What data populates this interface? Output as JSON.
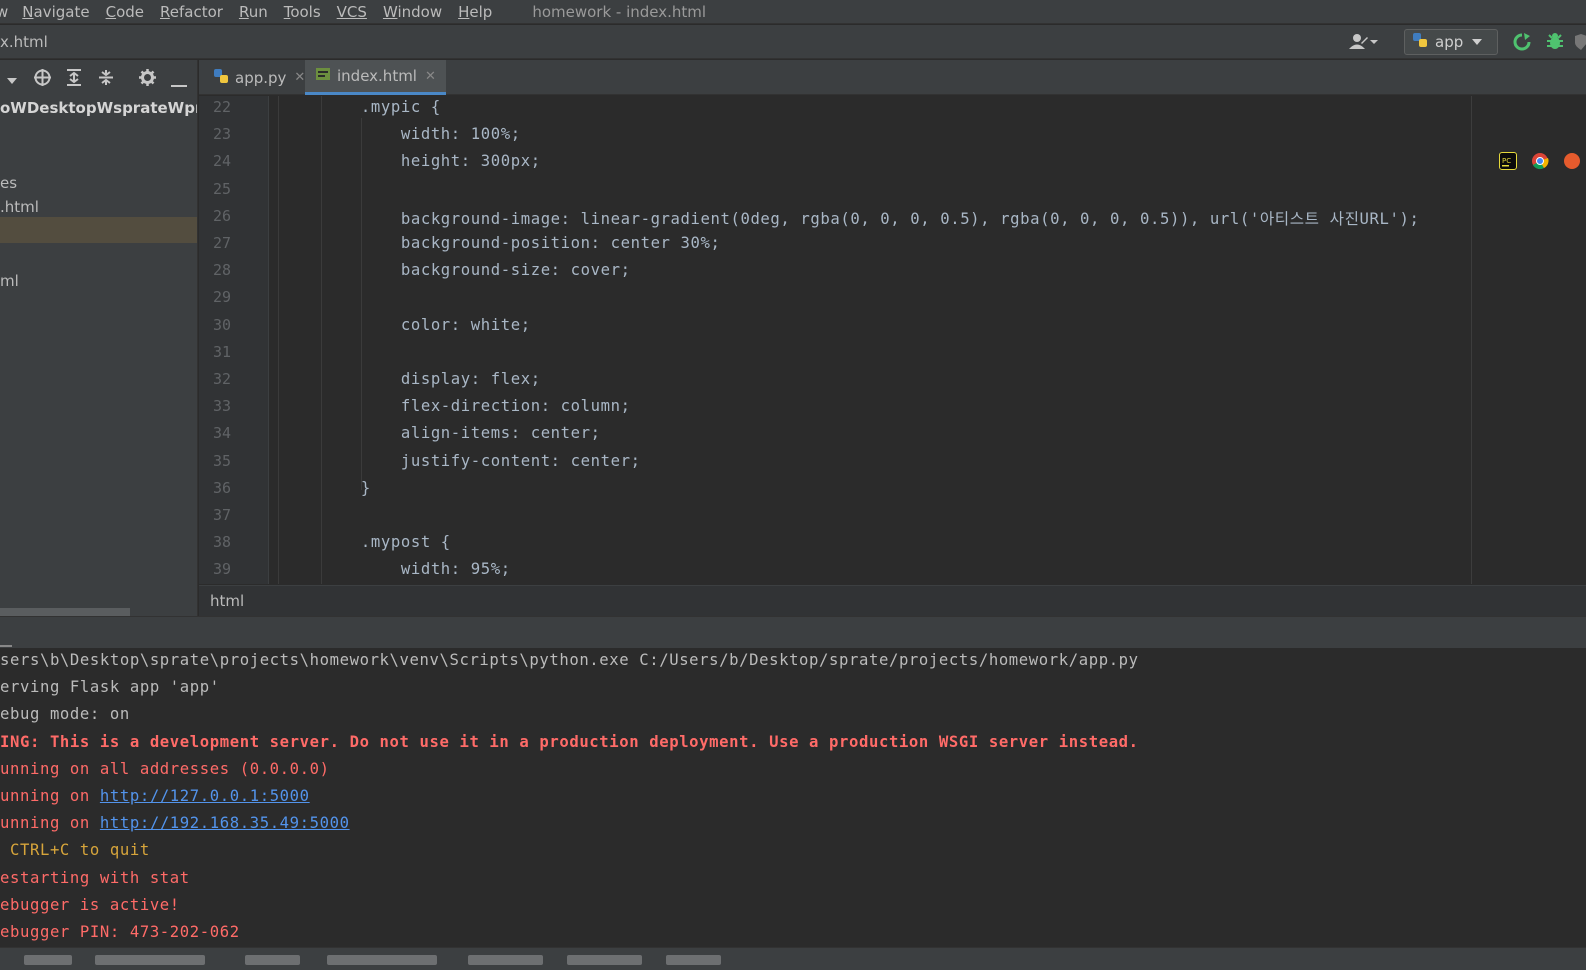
{
  "menu": {
    "partial_first": "w",
    "items": [
      {
        "mnemonic": "N",
        "rest": "avigate"
      },
      {
        "mnemonic": "C",
        "rest": "ode"
      },
      {
        "mnemonic": "R",
        "rest": "efactor"
      },
      {
        "mnemonic": "R",
        "rest": "un"
      },
      {
        "mnemonic": "T",
        "rest": "ools"
      },
      {
        "mnemonic": "VCS",
        "rest": ""
      },
      {
        "mnemonic": "W",
        "rest": "indow"
      },
      {
        "mnemonic": "H",
        "rest": "elp"
      }
    ],
    "window_title": "homework - index.html"
  },
  "navbar": {
    "file": "x.html",
    "run_config": "app"
  },
  "project_panel": {
    "rows": [
      {
        "label": "oWDesktopWsprateWprojectsW",
        "type": "root"
      },
      {
        "label": "",
        "type": "plain"
      },
      {
        "label": "es",
        "type": "plain"
      },
      {
        "label": ".html",
        "type": "plain"
      },
      {
        "label": "",
        "type": "selected"
      },
      {
        "label": "",
        "type": "plain"
      },
      {
        "label": "ml",
        "type": "plain"
      }
    ]
  },
  "tabs": [
    {
      "label": "app.py",
      "icon": "python-file-icon",
      "active": false
    },
    {
      "label": "index.html",
      "icon": "html-file-icon",
      "active": true
    }
  ],
  "editor": {
    "lines": [
      {
        "num": "22",
        "text": "        .mypic {",
        "kind": "selector",
        "selector": "mypic"
      },
      {
        "num": "23",
        "text": "            width: 100%;"
      },
      {
        "num": "24",
        "text": "            height: 300px;"
      },
      {
        "num": "25",
        "text": ""
      },
      {
        "num": "26",
        "text": "            background-image: linear-gradient(0deg, rgba(0, 0, 0, 0.5), rgba(0, 0, 0, 0.5)), url('아티스트 사진URL');"
      },
      {
        "num": "27",
        "text": "            background-position: center 30%;"
      },
      {
        "num": "28",
        "text": "            background-size: cover;"
      },
      {
        "num": "29",
        "text": ""
      },
      {
        "num": "30",
        "text": "            color: white;"
      },
      {
        "num": "31",
        "text": ""
      },
      {
        "num": "32",
        "text": "            display: flex;"
      },
      {
        "num": "33",
        "text": "            flex-direction: column;"
      },
      {
        "num": "34",
        "text": "            align-items: center;"
      },
      {
        "num": "35",
        "text": "            justify-content: center;"
      },
      {
        "num": "36",
        "text": "        }"
      },
      {
        "num": "37",
        "text": ""
      },
      {
        "num": "38",
        "text": "        .mypost {",
        "kind": "selector",
        "selector": "mypost"
      },
      {
        "num": "39",
        "text": "            width: 95%;"
      }
    ],
    "breadcrumb": "html"
  },
  "console": {
    "lines": [
      {
        "text": "sers\\b\\Desktop\\sprate\\projects\\homework\\venv\\Scripts\\python.exe C:/Users/b/Desktop/sprate/projects/homework/app.py",
        "style": "plain"
      },
      {
        "text": "erving Flask app 'app'",
        "style": "plain"
      },
      {
        "text": "ebug mode: on",
        "style": "plain"
      },
      {
        "text": "ING: This is a development server. Do not use it in a production deployment. Use a production WSGI server instead.",
        "style": "warn"
      },
      {
        "text": "unning on all addresses (0.0.0.0)",
        "style": "red"
      },
      {
        "text": "unning on ",
        "link": "http://127.0.0.1:5000",
        "style": "red"
      },
      {
        "text": "unning on ",
        "link": "http://192.168.35.49:5000",
        "style": "red"
      },
      {
        "text": " CTRL+C to quit",
        "style": "yellow"
      },
      {
        "text": "estarting with stat",
        "style": "red"
      },
      {
        "text": "ebugger is active!",
        "style": "red"
      },
      {
        "text": "ebugger PIN: 473-202-062",
        "style": "red"
      }
    ]
  },
  "colors": {
    "accent": "#4a88c7",
    "error": "#ff6b68",
    "link": "#5394ec",
    "warning_yellow": "#d7a53b"
  }
}
